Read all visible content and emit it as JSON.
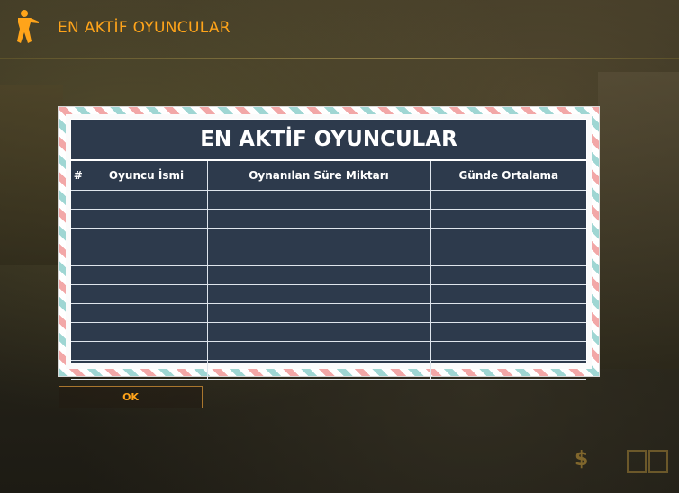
{
  "window": {
    "title": "EN AKTİF OYUNCULAR",
    "icon": "counter-strike-icon"
  },
  "board": {
    "title": "EN AKTİF OYUNCULAR",
    "columns": [
      "#",
      "Oyuncu İsmi",
      "Oynanılan Süre Miktarı",
      "Günde Ortalama"
    ],
    "rows": [
      [
        "",
        "",
        "",
        ""
      ],
      [
        "",
        "",
        "",
        ""
      ],
      [
        "",
        "",
        "",
        ""
      ],
      [
        "",
        "",
        "",
        ""
      ],
      [
        "",
        "",
        "",
        ""
      ],
      [
        "",
        "",
        "",
        ""
      ],
      [
        "",
        "",
        "",
        ""
      ],
      [
        "",
        "",
        "",
        ""
      ],
      [
        "",
        "",
        "",
        ""
      ],
      [
        "",
        "",
        "",
        ""
      ]
    ]
  },
  "ok_button": {
    "label": "OK"
  },
  "hud": {
    "money_symbol": "$"
  },
  "colors": {
    "accent": "#ffa41a",
    "board_bg": "#2d3a4c",
    "stripe_teal": "#9fd6d3",
    "stripe_pink": "#f2a7a7"
  }
}
